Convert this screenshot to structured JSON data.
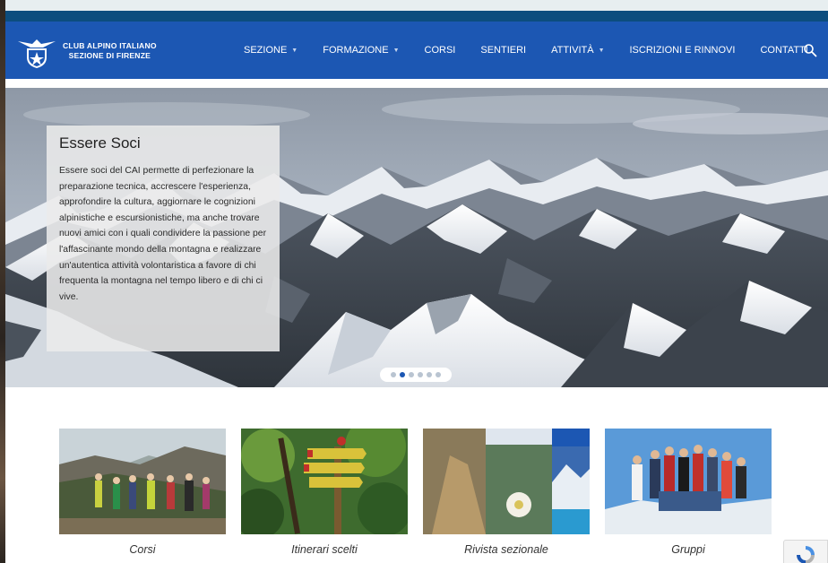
{
  "topbar": {
    "text": "",
    "right_text": ""
  },
  "brand": {
    "line1": "CLUB ALPINO ITALIANO",
    "line2": "SEZIONE DI FIRENZE"
  },
  "nav": {
    "items": [
      {
        "label": "SEZIONE",
        "has_dropdown": true
      },
      {
        "label": "FORMAZIONE",
        "has_dropdown": true
      },
      {
        "label": "CORSI",
        "has_dropdown": false
      },
      {
        "label": "SENTIERI",
        "has_dropdown": false
      },
      {
        "label": "ATTIVITÀ",
        "has_dropdown": true
      },
      {
        "label": "ISCRIZIONI E RINNOVI",
        "has_dropdown": false
      },
      {
        "label": "CONTATTI",
        "has_dropdown": false
      }
    ],
    "search_icon": "search-icon"
  },
  "hero": {
    "title": "Essere Soci",
    "text": "Essere soci del CAI permette di perfezionare la preparazione tecnica, accrescere l'esperienza, approfondire la cultura, aggiornare le cognizioni alpinistiche e escursionistiche, ma anche trovare nuovi amici con i quali condividere la passione per l'affascinante mondo della montagna e realizzare un'autentica attività volontaristica a favore di chi frequenta la montagna nel tempo libero e di chi ci vive.",
    "slide_count": 6,
    "active_slide": 2
  },
  "gallery": [
    {
      "caption": "Corsi"
    },
    {
      "caption": "Itinerari scelti"
    },
    {
      "caption": "Rivista sezionale"
    },
    {
      "caption": "Gruppi"
    }
  ],
  "colors": {
    "header": "#1c57b3",
    "topbar": "#0c4d7e",
    "accent": "#1c57b3"
  }
}
